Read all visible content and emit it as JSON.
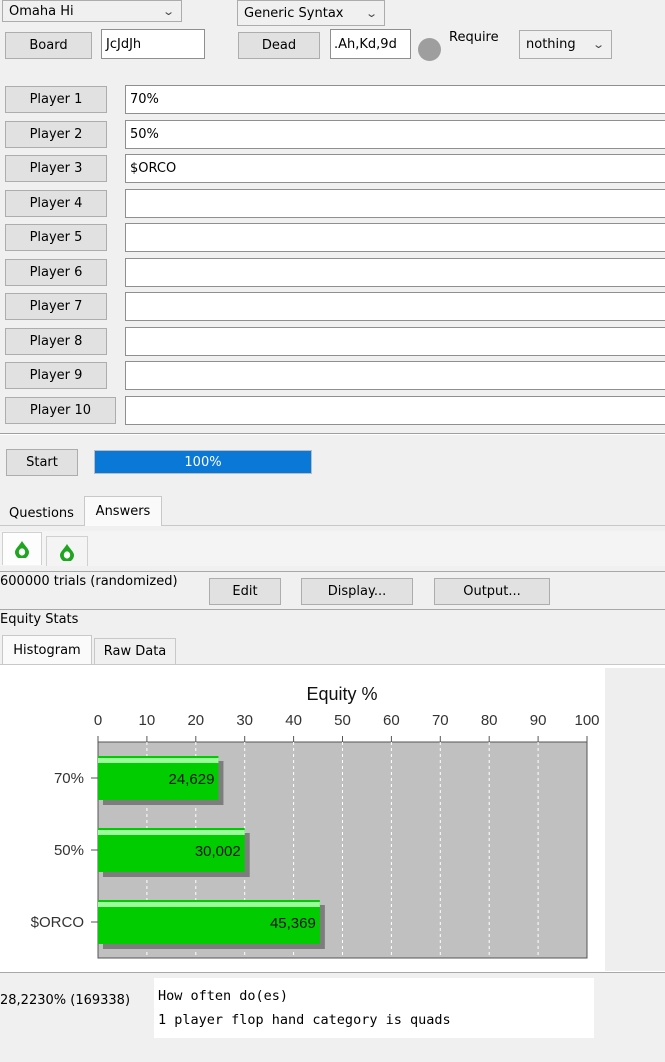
{
  "top": {
    "game_select": "Omaha Hi",
    "syntax_select": "Generic Syntax",
    "board_button": "Board",
    "board_value": "JcJdJh",
    "dead_button": "Dead",
    "dead_value": ".Ah,Kd,9d",
    "require_label": "Require",
    "require_select": "nothing"
  },
  "players": [
    {
      "label": "Player 1",
      "value": "70%"
    },
    {
      "label": "Player 2",
      "value": "50%"
    },
    {
      "label": "Player 3",
      "value": "$ORCO"
    },
    {
      "label": "Player 4",
      "value": ""
    },
    {
      "label": "Player 5",
      "value": ""
    },
    {
      "label": "Player 6",
      "value": ""
    },
    {
      "label": "Player 7",
      "value": ""
    },
    {
      "label": "Player 8",
      "value": ""
    },
    {
      "label": "Player 9",
      "value": ""
    },
    {
      "label": "Player 10",
      "value": ""
    }
  ],
  "run": {
    "start_button": "Start",
    "progress_text": "100%",
    "progress_value": 1.0
  },
  "tabs": {
    "questions": "Questions",
    "answers": "Answers"
  },
  "results": {
    "trials": "600000 trials (randomized)",
    "edit_button": "Edit",
    "display_button": "Display...",
    "output_button": "Output...",
    "equity_stats": "Equity Stats",
    "tab_histogram": "Histogram",
    "tab_raw": "Raw Data"
  },
  "footer": {
    "stat": "28,2230% (169338)",
    "question_line1": "How often do(es)",
    "question_line2": "1 player flop hand category is quads"
  },
  "colors": {
    "bar_green": "#00cc00",
    "progress_blue": "#0a78d7",
    "plot_bg": "#c0c0c0"
  },
  "chart_data": {
    "type": "bar",
    "orientation": "horizontal",
    "title": "Equity %",
    "categories": [
      "70%",
      "50%",
      "$ORCO"
    ],
    "values": [
      24.629,
      30.002,
      45.369
    ],
    "value_labels": [
      "24,629",
      "30,002",
      "45,369"
    ],
    "xlim": [
      0,
      100
    ],
    "xticks": [
      "0",
      "10",
      "20",
      "30",
      "40",
      "50",
      "60",
      "70",
      "80",
      "90",
      "100"
    ],
    "grid": true
  }
}
